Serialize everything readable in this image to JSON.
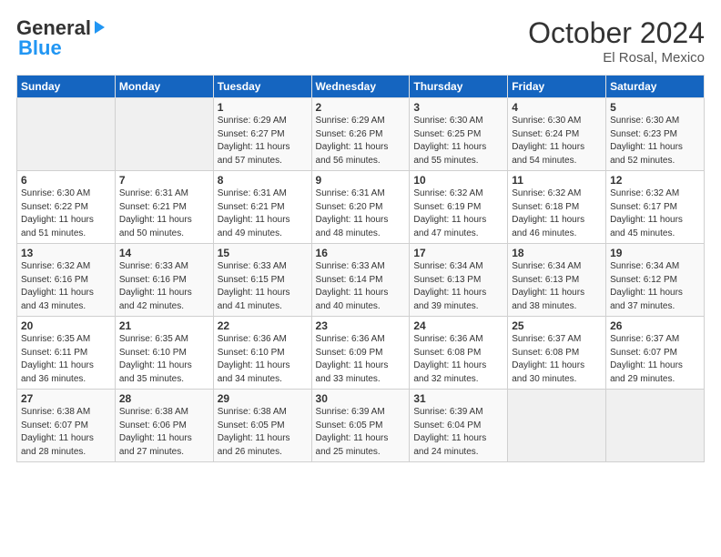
{
  "header": {
    "logo_general": "General",
    "logo_blue": "Blue",
    "month": "October 2024",
    "location": "El Rosal, Mexico"
  },
  "days_of_week": [
    "Sunday",
    "Monday",
    "Tuesday",
    "Wednesday",
    "Thursday",
    "Friday",
    "Saturday"
  ],
  "weeks": [
    [
      {
        "day": "",
        "info": ""
      },
      {
        "day": "",
        "info": ""
      },
      {
        "day": "1",
        "info": "Sunrise: 6:29 AM\nSunset: 6:27 PM\nDaylight: 11 hours and 57 minutes."
      },
      {
        "day": "2",
        "info": "Sunrise: 6:29 AM\nSunset: 6:26 PM\nDaylight: 11 hours and 56 minutes."
      },
      {
        "day": "3",
        "info": "Sunrise: 6:30 AM\nSunset: 6:25 PM\nDaylight: 11 hours and 55 minutes."
      },
      {
        "day": "4",
        "info": "Sunrise: 6:30 AM\nSunset: 6:24 PM\nDaylight: 11 hours and 54 minutes."
      },
      {
        "day": "5",
        "info": "Sunrise: 6:30 AM\nSunset: 6:23 PM\nDaylight: 11 hours and 52 minutes."
      }
    ],
    [
      {
        "day": "6",
        "info": "Sunrise: 6:30 AM\nSunset: 6:22 PM\nDaylight: 11 hours and 51 minutes."
      },
      {
        "day": "7",
        "info": "Sunrise: 6:31 AM\nSunset: 6:21 PM\nDaylight: 11 hours and 50 minutes."
      },
      {
        "day": "8",
        "info": "Sunrise: 6:31 AM\nSunset: 6:21 PM\nDaylight: 11 hours and 49 minutes."
      },
      {
        "day": "9",
        "info": "Sunrise: 6:31 AM\nSunset: 6:20 PM\nDaylight: 11 hours and 48 minutes."
      },
      {
        "day": "10",
        "info": "Sunrise: 6:32 AM\nSunset: 6:19 PM\nDaylight: 11 hours and 47 minutes."
      },
      {
        "day": "11",
        "info": "Sunrise: 6:32 AM\nSunset: 6:18 PM\nDaylight: 11 hours and 46 minutes."
      },
      {
        "day": "12",
        "info": "Sunrise: 6:32 AM\nSunset: 6:17 PM\nDaylight: 11 hours and 45 minutes."
      }
    ],
    [
      {
        "day": "13",
        "info": "Sunrise: 6:32 AM\nSunset: 6:16 PM\nDaylight: 11 hours and 43 minutes."
      },
      {
        "day": "14",
        "info": "Sunrise: 6:33 AM\nSunset: 6:16 PM\nDaylight: 11 hours and 42 minutes."
      },
      {
        "day": "15",
        "info": "Sunrise: 6:33 AM\nSunset: 6:15 PM\nDaylight: 11 hours and 41 minutes."
      },
      {
        "day": "16",
        "info": "Sunrise: 6:33 AM\nSunset: 6:14 PM\nDaylight: 11 hours and 40 minutes."
      },
      {
        "day": "17",
        "info": "Sunrise: 6:34 AM\nSunset: 6:13 PM\nDaylight: 11 hours and 39 minutes."
      },
      {
        "day": "18",
        "info": "Sunrise: 6:34 AM\nSunset: 6:13 PM\nDaylight: 11 hours and 38 minutes."
      },
      {
        "day": "19",
        "info": "Sunrise: 6:34 AM\nSunset: 6:12 PM\nDaylight: 11 hours and 37 minutes."
      }
    ],
    [
      {
        "day": "20",
        "info": "Sunrise: 6:35 AM\nSunset: 6:11 PM\nDaylight: 11 hours and 36 minutes."
      },
      {
        "day": "21",
        "info": "Sunrise: 6:35 AM\nSunset: 6:10 PM\nDaylight: 11 hours and 35 minutes."
      },
      {
        "day": "22",
        "info": "Sunrise: 6:36 AM\nSunset: 6:10 PM\nDaylight: 11 hours and 34 minutes."
      },
      {
        "day": "23",
        "info": "Sunrise: 6:36 AM\nSunset: 6:09 PM\nDaylight: 11 hours and 33 minutes."
      },
      {
        "day": "24",
        "info": "Sunrise: 6:36 AM\nSunset: 6:08 PM\nDaylight: 11 hours and 32 minutes."
      },
      {
        "day": "25",
        "info": "Sunrise: 6:37 AM\nSunset: 6:08 PM\nDaylight: 11 hours and 30 minutes."
      },
      {
        "day": "26",
        "info": "Sunrise: 6:37 AM\nSunset: 6:07 PM\nDaylight: 11 hours and 29 minutes."
      }
    ],
    [
      {
        "day": "27",
        "info": "Sunrise: 6:38 AM\nSunset: 6:07 PM\nDaylight: 11 hours and 28 minutes."
      },
      {
        "day": "28",
        "info": "Sunrise: 6:38 AM\nSunset: 6:06 PM\nDaylight: 11 hours and 27 minutes."
      },
      {
        "day": "29",
        "info": "Sunrise: 6:38 AM\nSunset: 6:05 PM\nDaylight: 11 hours and 26 minutes."
      },
      {
        "day": "30",
        "info": "Sunrise: 6:39 AM\nSunset: 6:05 PM\nDaylight: 11 hours and 25 minutes."
      },
      {
        "day": "31",
        "info": "Sunrise: 6:39 AM\nSunset: 6:04 PM\nDaylight: 11 hours and 24 minutes."
      },
      {
        "day": "",
        "info": ""
      },
      {
        "day": "",
        "info": ""
      }
    ]
  ]
}
